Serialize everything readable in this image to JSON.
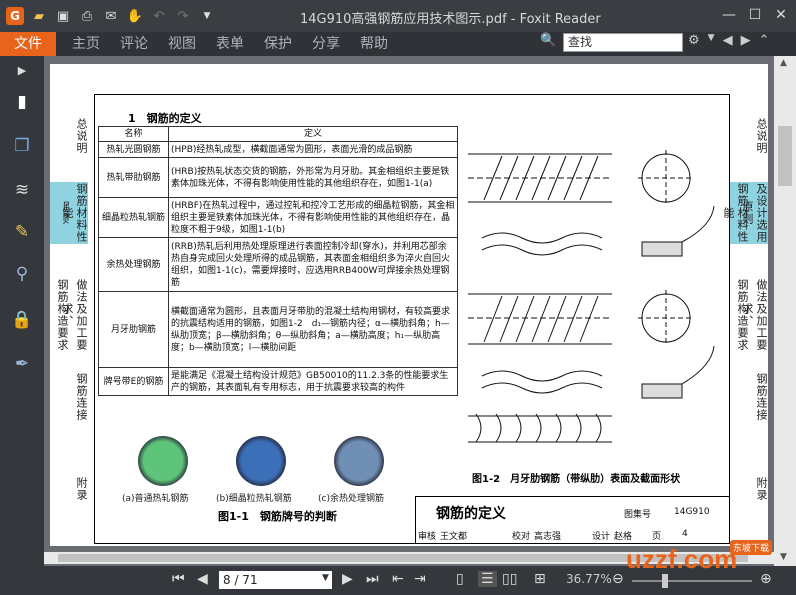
{
  "app": {
    "window_title": "14G910高强钢筋应用技术图示.pdf - Foxit Reader",
    "logo_letter": "G"
  },
  "menu": [
    "文件",
    "主页",
    "评论",
    "视图",
    "表单",
    "保护",
    "分享",
    "帮助"
  ],
  "search": {
    "placeholder": "查找"
  },
  "navigation": {
    "page_display": "8 / 71",
    "zoom": "36.77%"
  },
  "watermark": {
    "text": "uzzf.com",
    "badge": "东坡下载"
  },
  "document": {
    "side_tabs_left": [
      "总说明",
      "及设计选用原则",
      "钢筋材料性能",
      "钢筋构造要求",
      "做法及加工要求、",
      "钢筋连接",
      "附录"
    ],
    "side_tabs_right": [
      "总说明",
      "及设计选用原则",
      "钢筋材料性能",
      "钢筋构造要求",
      "做法及加工要求、",
      "钢筋连接",
      "附录"
    ],
    "section_title": "1　钢筋的定义",
    "table": {
      "headers": [
        "名称",
        "定义"
      ],
      "rows": [
        {
          "name": "热轧光圆钢筋",
          "def": "(HPB)经热轧成型，横截面通常为圆形，表面光滑的成品钢筋"
        },
        {
          "name": "热轧带肋钢筋",
          "def": "(HRB)按热轧状态交货的钢筋，外形常为月牙肋。其金相组织主要是铁素体加珠光体，不得有影响使用性能的其他组织存在，如图1-1(a)"
        },
        {
          "name": "细晶粒热轧钢筋",
          "def": "(HRBF)在热轧过程中，通过控轧和控冷工艺形成的细晶粒钢筋，其金相组织主要是铁素体加珠光体，不得有影响使用性能的其他组织存在，晶粒度不粗于9级，如图1-1(b)"
        },
        {
          "name": "余热处理钢筋",
          "def": "(RRB)热轧后利用热处理原理进行表面控制冷却(穿水)，并利用芯部余热自身完成回火处理所得的成品钢筋，其表面金相组织多为淬火自回火组织，如图1-1(c)，需要焊接时，应选用RRB400W可焊接余热处理钢筋"
        },
        {
          "name": "月牙肋钢筋",
          "def": "横截面通常为圆形，且表面月牙带肋的混凝土结构用钢材，有较高要求的抗震结构适用的钢筋，如图1-2　d₁—钢筋内径；α—横肋斜角；h—纵肋顶宽；β—横肋斜角；θ—纵肋斜角；a—横肋高度；h₁—纵肋高度；b—横肋顶宽；l—横肋间距"
        },
        {
          "name": "牌号带E的钢筋",
          "def": "是能满足《混凝土结构设计规范》GB50010的11.2.3条的性能要求生产的钢筋，其表面轧有专用标志，用于抗震要求较高的构件"
        }
      ]
    },
    "photos": [
      {
        "caption": "(a)普通热轧钢筋",
        "color": "#5dc47a"
      },
      {
        "caption": "(b)细晶粒热轧钢筋",
        "color": "#3b6fb8"
      },
      {
        "caption": "(c)余热处理钢筋",
        "color": "#6f8fb4"
      }
    ],
    "fig1_title": "图1-1　钢筋牌号的判断",
    "fig2_title": "图1-2　月牙肋钢筋（带纵肋）表面及截面形状",
    "title_block": {
      "main": "钢筋的定义",
      "atlas_label": "图集号",
      "atlas_no": "14G910",
      "page_label": "页",
      "page_no": "4",
      "review_label": "审核",
      "review_name": "王文都",
      "check_label": "校对",
      "check_name": "高志强",
      "design_label": "设计",
      "design_name": "赵格"
    }
  },
  "colors": {
    "accent": "#e8641b",
    "highlight": "#8fd3e0"
  }
}
